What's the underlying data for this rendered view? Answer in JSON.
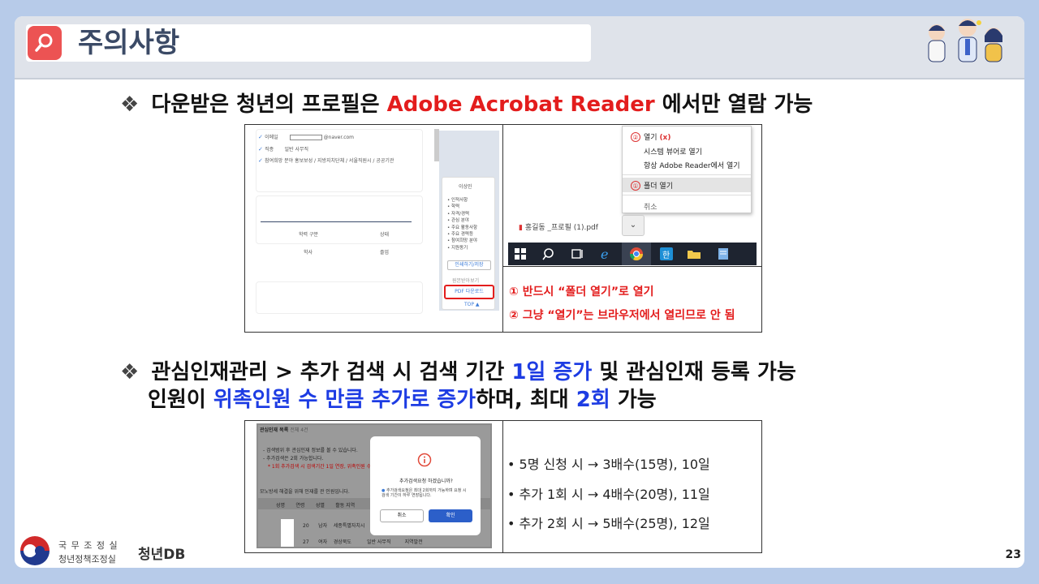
{
  "header": {
    "title": "주의사항",
    "icon": "search-icon"
  },
  "section1": {
    "bullet": "❖",
    "text_before": "다운받은 청년의 프로필은",
    "highlight": "Adobe Acrobat Reader",
    "text_after": "에서만 열람 가능"
  },
  "profile_shot": {
    "fields": [
      {
        "label": "이메일",
        "value": "@naver.com"
      },
      {
        "label": "직종",
        "value": "일반 사무직"
      },
      {
        "label": "참여희망 분야",
        "value": "홍보보성 / 지방지치단체 / 서울직원시 / 공공기관"
      }
    ],
    "table_headers": [
      "학력 구분",
      "상태"
    ],
    "table_row": [
      "학사",
      "졸업"
    ],
    "menu_title": "이상민",
    "menu_items": [
      "인적사항",
      "학력",
      "자격/경력",
      "관심 분야",
      "주요 활동사항",
      "주요 경력등",
      "참여희망 분야",
      "지원동기"
    ],
    "btn_list": "인쇄하기/저장",
    "btn_more": "원본받아보기",
    "pdf_button": "PDF 다운로드",
    "top_link": "TOP ▲"
  },
  "context_menu": {
    "items": [
      {
        "num": "②",
        "label": "열기",
        "note": "(x)"
      },
      {
        "num": "",
        "label": "시스템 뷰어로 열기",
        "note": ""
      },
      {
        "num": "",
        "label": "항상 Adobe Reader에서 열기",
        "note": ""
      },
      {
        "num": "①",
        "label": "폴더 열기",
        "note": ""
      },
      {
        "num": "",
        "label": "취소",
        "note": ""
      }
    ],
    "download_file": "홍길동 _프로필 (1).pdf"
  },
  "instructions": {
    "line1": "① 반드시 “폴더 열기”로 열기",
    "line2": "② 그냥 “열기”는 브라우저에서 열리므로 안 됨"
  },
  "section2": {
    "bullet": "❖",
    "l1_a": "관심인재관리 > 추가 검색 시 검색 기간",
    "l1_highlight": "1일 증가",
    "l1_b": "및 관심인재 등록 가능",
    "l2_a": "인원이",
    "l2_highlight1": "위촉인원 수 만큼 추가로 증가",
    "l2_b": "하며, 최대",
    "l2_highlight2": "2회",
    "l2_c": "가능"
  },
  "talent_shot": {
    "title": "관심인재 목록",
    "subtitle": "전체 4건",
    "notes": [
      "- 검색범위 후 관심인재 정보를 볼 수 있습니다.",
      "- 추가검색은 2회 가능합니다.",
      "* 1회 추가검색 시 검색기간 1일 연장, 위촉인원 수 만큼 관심"
    ],
    "list_caption": "모노방세 해결을 위해 인재를 관 인원입니다.",
    "table_headers": [
      "성명",
      "연령",
      "성별",
      "활동 지역"
    ],
    "rows": [
      [
        "20",
        "남자",
        "세종특별자치시"
      ],
      [
        "27",
        "여자",
        "경상북도",
        "일반 사무직",
        "지역발전"
      ]
    ],
    "dialog_title": "추가검색요청 하겠습니까?",
    "dialog_note": "추가검색요청은 최대 2회까지 가능하며 요청 시 검색 기간이 하루 연장됩니다.",
    "cancel": "취소",
    "confirm": "확인"
  },
  "calc": [
    "• 5명 신청 시 → 3배수(15명), 10일",
    "• 추가 1회 시 → 4배수(20명), 11일",
    "• 추가 2회 시 → 5배수(25명), 12일"
  ],
  "footer": {
    "org_line1": "국 무 조 정 실",
    "org_line2": "청년정책조정실",
    "brand": "청년DB",
    "page": "23"
  }
}
